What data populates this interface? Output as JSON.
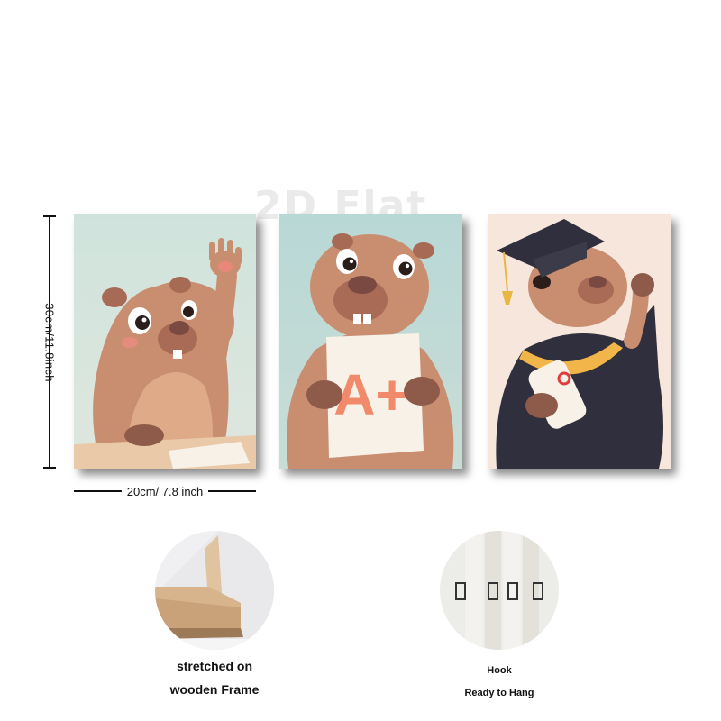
{
  "watermark": "2D Flat",
  "dimensions": {
    "height_label": "30cm/11.8inch",
    "width_label": "20cm/ 7.8 inch"
  },
  "panels": [
    {
      "subject": "capybara-raising-paw",
      "background": "#cfe3dc"
    },
    {
      "subject": "capybara-holding-paper",
      "paper_text": "A+",
      "background": "#b8d8d6"
    },
    {
      "subject": "capybara-graduate",
      "background": "#f7e6dc"
    }
  ],
  "details": {
    "frame_caption_line1": "stretched on",
    "frame_caption_line2": "wooden Frame",
    "hook_caption_line1": "Hook",
    "hook_caption_line2": "Ready to Hang"
  },
  "colors": {
    "fur": "#c98e70",
    "fur_dark": "#8e5a4a",
    "nose": "#7a4a42",
    "gown": "#2f2f3d",
    "sash": "#f2b54a",
    "grade": "#f08a6a",
    "wood": "#d8b48c"
  }
}
